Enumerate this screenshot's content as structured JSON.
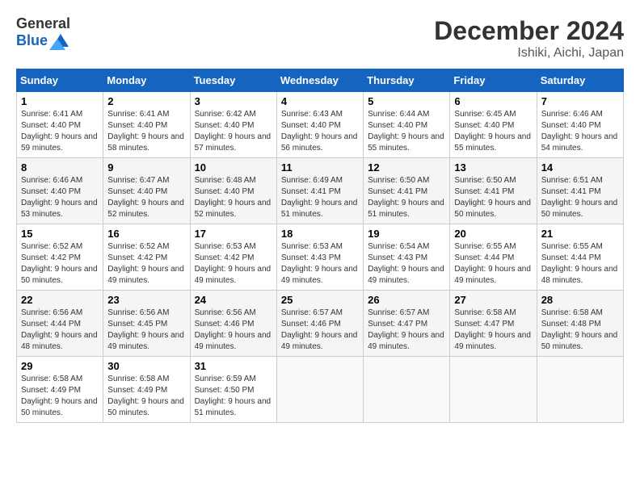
{
  "header": {
    "logo_general": "General",
    "logo_blue": "Blue",
    "month_title": "December 2024",
    "location": "Ishiki, Aichi, Japan"
  },
  "days_of_week": [
    "Sunday",
    "Monday",
    "Tuesday",
    "Wednesday",
    "Thursday",
    "Friday",
    "Saturday"
  ],
  "weeks": [
    [
      {
        "day": "1",
        "sunrise": "6:41 AM",
        "sunset": "4:40 PM",
        "daylight": "9 hours and 59 minutes."
      },
      {
        "day": "2",
        "sunrise": "6:41 AM",
        "sunset": "4:40 PM",
        "daylight": "9 hours and 58 minutes."
      },
      {
        "day": "3",
        "sunrise": "6:42 AM",
        "sunset": "4:40 PM",
        "daylight": "9 hours and 57 minutes."
      },
      {
        "day": "4",
        "sunrise": "6:43 AM",
        "sunset": "4:40 PM",
        "daylight": "9 hours and 56 minutes."
      },
      {
        "day": "5",
        "sunrise": "6:44 AM",
        "sunset": "4:40 PM",
        "daylight": "9 hours and 55 minutes."
      },
      {
        "day": "6",
        "sunrise": "6:45 AM",
        "sunset": "4:40 PM",
        "daylight": "9 hours and 55 minutes."
      },
      {
        "day": "7",
        "sunrise": "6:46 AM",
        "sunset": "4:40 PM",
        "daylight": "9 hours and 54 minutes."
      }
    ],
    [
      {
        "day": "8",
        "sunrise": "6:46 AM",
        "sunset": "4:40 PM",
        "daylight": "9 hours and 53 minutes."
      },
      {
        "day": "9",
        "sunrise": "6:47 AM",
        "sunset": "4:40 PM",
        "daylight": "9 hours and 52 minutes."
      },
      {
        "day": "10",
        "sunrise": "6:48 AM",
        "sunset": "4:40 PM",
        "daylight": "9 hours and 52 minutes."
      },
      {
        "day": "11",
        "sunrise": "6:49 AM",
        "sunset": "4:41 PM",
        "daylight": "9 hours and 51 minutes."
      },
      {
        "day": "12",
        "sunrise": "6:50 AM",
        "sunset": "4:41 PM",
        "daylight": "9 hours and 51 minutes."
      },
      {
        "day": "13",
        "sunrise": "6:50 AM",
        "sunset": "4:41 PM",
        "daylight": "9 hours and 50 minutes."
      },
      {
        "day": "14",
        "sunrise": "6:51 AM",
        "sunset": "4:41 PM",
        "daylight": "9 hours and 50 minutes."
      }
    ],
    [
      {
        "day": "15",
        "sunrise": "6:52 AM",
        "sunset": "4:42 PM",
        "daylight": "9 hours and 50 minutes."
      },
      {
        "day": "16",
        "sunrise": "6:52 AM",
        "sunset": "4:42 PM",
        "daylight": "9 hours and 49 minutes."
      },
      {
        "day": "17",
        "sunrise": "6:53 AM",
        "sunset": "4:42 PM",
        "daylight": "9 hours and 49 minutes."
      },
      {
        "day": "18",
        "sunrise": "6:53 AM",
        "sunset": "4:43 PM",
        "daylight": "9 hours and 49 minutes."
      },
      {
        "day": "19",
        "sunrise": "6:54 AM",
        "sunset": "4:43 PM",
        "daylight": "9 hours and 49 minutes."
      },
      {
        "day": "20",
        "sunrise": "6:55 AM",
        "sunset": "4:44 PM",
        "daylight": "9 hours and 49 minutes."
      },
      {
        "day": "21",
        "sunrise": "6:55 AM",
        "sunset": "4:44 PM",
        "daylight": "9 hours and 48 minutes."
      }
    ],
    [
      {
        "day": "22",
        "sunrise": "6:56 AM",
        "sunset": "4:44 PM",
        "daylight": "9 hours and 48 minutes."
      },
      {
        "day": "23",
        "sunrise": "6:56 AM",
        "sunset": "4:45 PM",
        "daylight": "9 hours and 49 minutes."
      },
      {
        "day": "24",
        "sunrise": "6:56 AM",
        "sunset": "4:46 PM",
        "daylight": "9 hours and 49 minutes."
      },
      {
        "day": "25",
        "sunrise": "6:57 AM",
        "sunset": "4:46 PM",
        "daylight": "9 hours and 49 minutes."
      },
      {
        "day": "26",
        "sunrise": "6:57 AM",
        "sunset": "4:47 PM",
        "daylight": "9 hours and 49 minutes."
      },
      {
        "day": "27",
        "sunrise": "6:58 AM",
        "sunset": "4:47 PM",
        "daylight": "9 hours and 49 minutes."
      },
      {
        "day": "28",
        "sunrise": "6:58 AM",
        "sunset": "4:48 PM",
        "daylight": "9 hours and 50 minutes."
      }
    ],
    [
      {
        "day": "29",
        "sunrise": "6:58 AM",
        "sunset": "4:49 PM",
        "daylight": "9 hours and 50 minutes."
      },
      {
        "day": "30",
        "sunrise": "6:58 AM",
        "sunset": "4:49 PM",
        "daylight": "9 hours and 50 minutes."
      },
      {
        "day": "31",
        "sunrise": "6:59 AM",
        "sunset": "4:50 PM",
        "daylight": "9 hours and 51 minutes."
      },
      null,
      null,
      null,
      null
    ]
  ]
}
